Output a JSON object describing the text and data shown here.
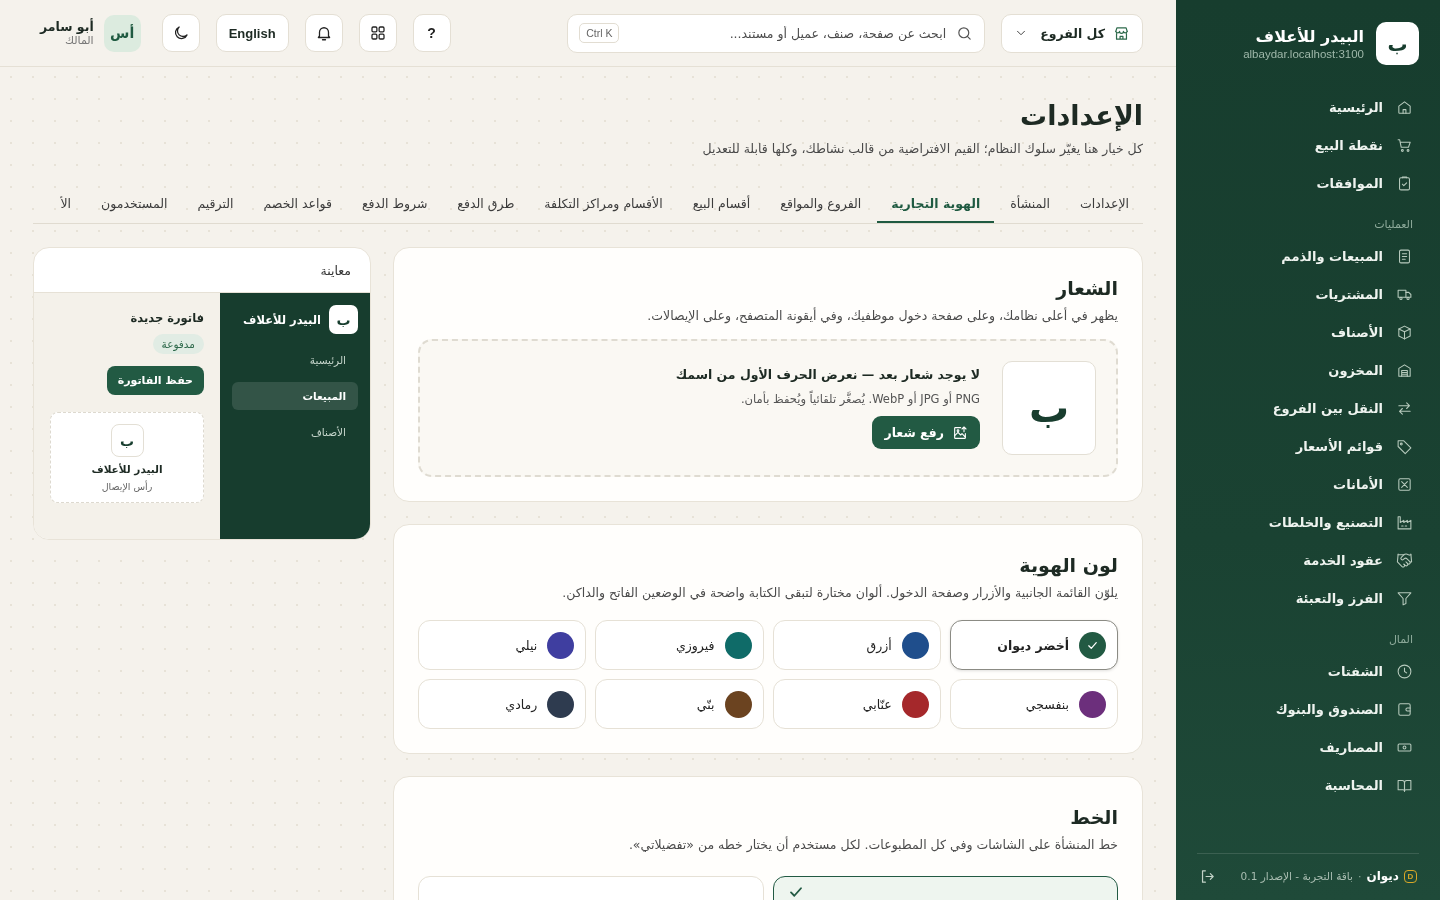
{
  "sidebar": {
    "logo_letter": "ب",
    "brand": "البيدر للأعلاف",
    "domain": "albaydar.localhost:3100",
    "sections": [
      {
        "items": [
          {
            "label": "الرئيسية",
            "selected": false
          },
          {
            "label": "نقطة البيع",
            "selected": false
          },
          {
            "label": "الموافقات",
            "selected": false
          }
        ]
      },
      {
        "label": "العمليات",
        "items": [
          {
            "label": "المبيعات والذمم",
            "selected": false
          },
          {
            "label": "المشتريات",
            "selected": false
          },
          {
            "label": "الأصناف",
            "selected": false
          },
          {
            "label": "المخزون",
            "selected": false
          },
          {
            "label": "النقل بين الفروع",
            "selected": false
          },
          {
            "label": "قوائم الأسعار",
            "selected": false
          },
          {
            "label": "الأمانات",
            "selected": false
          },
          {
            "label": "التصنيع والخلطات",
            "selected": false
          },
          {
            "label": "عقود الخدمة",
            "selected": false
          },
          {
            "label": "الفرز والتعبئة",
            "selected": false
          }
        ]
      },
      {
        "label": "المال",
        "items": [
          {
            "label": "الشفتات",
            "selected": false
          },
          {
            "label": "الصندوق والبنوك",
            "selected": false
          },
          {
            "label": "المصاريف",
            "selected": false
          },
          {
            "label": "المحاسبة",
            "selected": false
          }
        ]
      }
    ],
    "footer": {
      "logo_letter": "D",
      "product": "ديوان",
      "separator": "·",
      "version": "باقة التجربة - الإصدار 0.1"
    }
  },
  "topbar": {
    "branch_selector": {
      "label": "كل الفروع"
    },
    "search": {
      "placeholder": "ابحث عن صفحة، صنف، عميل أو مستند...",
      "shortcut": "Ctrl K"
    },
    "help_button": "?",
    "language_button": "English",
    "user": {
      "initials": "أس",
      "name": "أبو سامر",
      "role": "المالك"
    }
  },
  "header": {
    "title": "الإعدادات",
    "subtitle": "كل خيار هنا يغيّر سلوك النظام؛ القيم الافتراضية من قالب نشاطك، وكلها قابلة للتعديل"
  },
  "tabs": [
    {
      "label": "الإعدادات",
      "selected": false
    },
    {
      "label": "المنشأة",
      "selected": false
    },
    {
      "label": "الهوية التجارية",
      "selected": true
    },
    {
      "label": "الفروع والمواقع",
      "selected": false
    },
    {
      "label": "أقسام البيع",
      "selected": false
    },
    {
      "label": "الأقسام ومراكز التكلفة",
      "selected": false
    },
    {
      "label": "طرق الدفع",
      "selected": false
    },
    {
      "label": "شروط الدفع",
      "selected": false
    },
    {
      "label": "قواعد الخصم",
      "selected": false
    },
    {
      "label": "الترقيم",
      "selected": false
    },
    {
      "label": "المستخدمون",
      "selected": false
    },
    {
      "label": "الأ",
      "selected": false
    }
  ],
  "logo_section": {
    "title": "الشعار",
    "description": "يظهر في أعلى نظامك، وعلى صفحة دخول موظفيك، وفي أيقونة المتصفح، وعلى الإيصالات.",
    "placeholder_letter": "ب",
    "empty_title": "لا يوجد شعار بعد — نعرض الحرف الأول من اسمك",
    "empty_hint": "PNG أو JPG أو WebP. يُصغَّر تلقائياً ويُحفظ بأمان.",
    "upload_button": "رفع شعار"
  },
  "color_section": {
    "title": "لون الهوية",
    "description": "يلوّن القائمة الجانبية والأزرار وصفحة الدخول. ألوان مختارة لتبقى الكتابة واضحة في الوضعين الفاتح والداكن.",
    "options": [
      {
        "name": "أخضر ديوان",
        "color": "#225a43",
        "selected": true
      },
      {
        "name": "أزرق",
        "color": "#1f4e8c",
        "selected": false
      },
      {
        "name": "فيروزي",
        "color": "#0f6b68",
        "selected": false
      },
      {
        "name": "نيلي",
        "color": "#3f3ea0",
        "selected": false
      },
      {
        "name": "بنفسجي",
        "color": "#6c2f7c",
        "selected": false
      },
      {
        "name": "عنّابي",
        "color": "#a5282b",
        "selected": false
      },
      {
        "name": "بنّي",
        "color": "#6b4320",
        "selected": false
      },
      {
        "name": "رمادي",
        "color": "#2e3b4f",
        "selected": false
      }
    ]
  },
  "font_section": {
    "title": "الخط",
    "description": "خط المنشأة على الشاشات وفي كل المطبوعات. لكل مستخدم أن يختار خطه من «تفضيلاتي».",
    "options": [
      {
        "selected": true
      },
      {
        "selected": false
      }
    ]
  },
  "preview": {
    "title": "معاينة",
    "sidebar": {
      "logo_letter": "ب",
      "brand": "البيدر للأعلاف",
      "items": [
        {
          "label": "الرئيسية",
          "selected": false
        },
        {
          "label": "المبيعات",
          "selected": true
        },
        {
          "label": "الأصناف",
          "selected": false
        }
      ]
    },
    "invoice": {
      "title": "فاتورة جديدة",
      "status": "مدفوعة",
      "save_button": "حفظ الفاتورة"
    },
    "receipt": {
      "logo_letter": "ب",
      "brand": "البيدر للأعلاف",
      "caption": "رأس الإيصال"
    }
  }
}
